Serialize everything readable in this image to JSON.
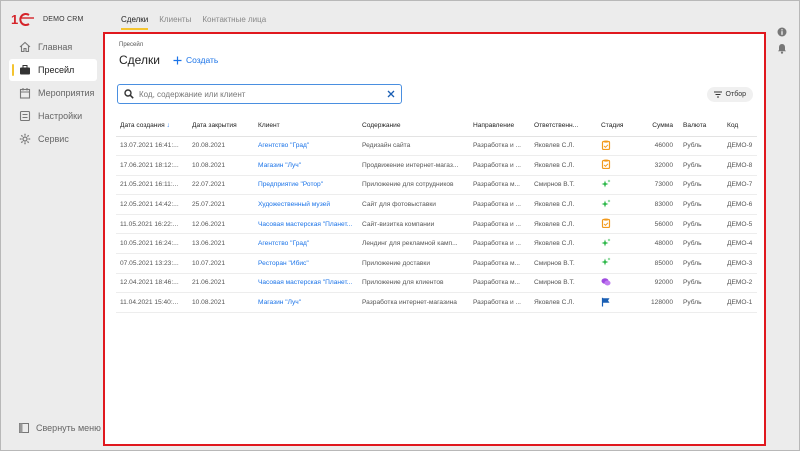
{
  "app": {
    "logo_text": "DEMO CRM"
  },
  "sidebar": {
    "items": [
      {
        "label": "Главная",
        "icon": "home-icon",
        "active": false
      },
      {
        "label": "Пресейл",
        "icon": "briefcase-icon",
        "active": true
      },
      {
        "label": "Мероприятия",
        "icon": "calendar-icon",
        "active": false
      },
      {
        "label": "Настройки",
        "icon": "settings-icon",
        "active": false
      },
      {
        "label": "Сервис",
        "icon": "gear-icon",
        "active": false
      }
    ],
    "collapse_label": "Свернуть меню"
  },
  "tabs": [
    "Сделки",
    "Клиенты",
    "Контактные лица"
  ],
  "main": {
    "breadcrumb": "Пресейл",
    "title": "Сделки",
    "create_label": "Создать",
    "search_placeholder": "Код, содержание или клиент",
    "filter_label": "Отбор"
  },
  "table": {
    "columns": [
      "Дата создания",
      "Дата закрытия",
      "Клиент",
      "Содержание",
      "Направление",
      "Ответственн...",
      "Стадия",
      "Сумма",
      "Валюта",
      "Код"
    ],
    "sort_indicator": "↓",
    "rows": [
      {
        "created": "13.07.2021 16:41:...",
        "closed": "20.08.2021",
        "client": "Агентство \"Град\"",
        "content": "Редизайн сайта",
        "direction": "Разработка и ...",
        "owner": "Яковлев С.Л.",
        "stage": "clipboard",
        "sum": "46000",
        "currency": "Рубль",
        "code": "ДЕМО-9"
      },
      {
        "created": "17.06.2021 18:12:...",
        "closed": "10.08.2021",
        "client": "Магазин \"Луч\"",
        "content": "Продвижение интернет-магаз...",
        "direction": "Разработка и ...",
        "owner": "Яковлев С.Л.",
        "stage": "clipboard",
        "sum": "32000",
        "currency": "Рубль",
        "code": "ДЕМО-8"
      },
      {
        "created": "21.05.2021 16:11:...",
        "closed": "22.07.2021",
        "client": "Предприятие \"Ротор\"",
        "content": "Приложение для сотрудников",
        "direction": "Разработка м...",
        "owner": "Смирнов В.Т.",
        "stage": "sparkle",
        "sum": "73000",
        "currency": "Рубль",
        "code": "ДЕМО-7"
      },
      {
        "created": "12.05.2021 14:42:...",
        "closed": "25.07.2021",
        "client": "Художественный музей",
        "content": "Сайт для фотовыставки",
        "direction": "Разработка и ...",
        "owner": "Яковлев С.Л.",
        "stage": "sparkle",
        "sum": "83000",
        "currency": "Рубль",
        "code": "ДЕМО-6"
      },
      {
        "created": "11.05.2021 16:22:...",
        "closed": "12.06.2021",
        "client": "Часовая мастерская \"Планет...",
        "content": "Сайт-визитка компании",
        "direction": "Разработка и ...",
        "owner": "Яковлев С.Л.",
        "stage": "clipboard",
        "sum": "56000",
        "currency": "Рубль",
        "code": "ДЕМО-5"
      },
      {
        "created": "10.05.2021 16:24:...",
        "closed": "13.06.2021",
        "client": "Агентство \"Град\"",
        "content": "Лендинг для рекламной камп...",
        "direction": "Разработка и ...",
        "owner": "Яковлев С.Л.",
        "stage": "sparkle",
        "sum": "48000",
        "currency": "Рубль",
        "code": "ДЕМО-4"
      },
      {
        "created": "07.05.2021 13:23:...",
        "closed": "10.07.2021",
        "client": "Ресторан \"Ибис\"",
        "content": "Приложение доставки",
        "direction": "Разработка м...",
        "owner": "Смирнов В.Т.",
        "stage": "sparkle",
        "sum": "85000",
        "currency": "Рубль",
        "code": "ДЕМО-3"
      },
      {
        "created": "12.04.2021 18:46:...",
        "closed": "21.06.2021",
        "client": "Часовая мастерская \"Планет...",
        "content": "Приложение для клиентов",
        "direction": "Разработка м...",
        "owner": "Смирнов В.Т.",
        "stage": "chat",
        "sum": "92000",
        "currency": "Рубль",
        "code": "ДЕМО-2"
      },
      {
        "created": "11.04.2021 15:40:...",
        "closed": "10.08.2021",
        "client": "Магазин \"Луч\"",
        "content": "Разработка интернет-магазина",
        "direction": "Разработка и ...",
        "owner": "Яковлев С.Л.",
        "stage": "flag",
        "sum": "128000",
        "currency": "Рубль",
        "code": "ДЕМО-1"
      }
    ]
  },
  "colors": {
    "accent": "#f4c430",
    "link": "#1a73e8",
    "highlight_border": "#e0181e"
  }
}
